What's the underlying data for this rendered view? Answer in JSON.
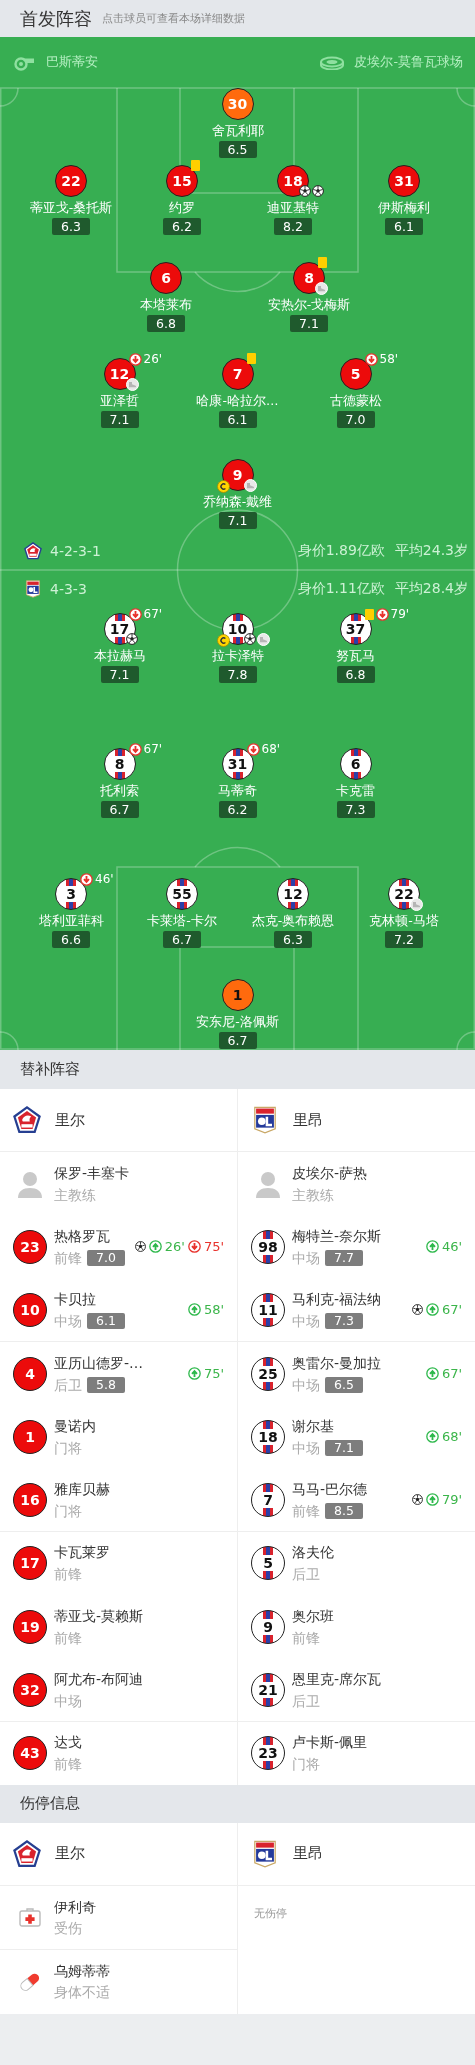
{
  "header": {
    "title": "首发阵容",
    "hint": "点击球员可查看本场详细数据"
  },
  "match_info": {
    "referee": "巴斯蒂安",
    "stadium": "皮埃尔-莫鲁瓦球场"
  },
  "home": {
    "formation": "4-2-3-1",
    "value": "身价1.89亿欧",
    "average_age": "平均24.3岁",
    "goalkeeper": {
      "number": "30",
      "name": "舍瓦利耶",
      "rating": "6.5",
      "captain": false
    },
    "lines": [
      [
        {
          "number": "22",
          "name": "蒂亚戈-桑托斯",
          "rating": "6.3",
          "captain": false
        },
        {
          "number": "15",
          "name": "约罗",
          "rating": "6.2",
          "captain": false,
          "events": [
            {
              "kind": "yellow_card"
            }
          ]
        },
        {
          "number": "18",
          "name": "迪亚基特",
          "rating": "8.2",
          "captain": false,
          "events": [
            {
              "kind": "goal"
            },
            {
              "kind": "goal"
            }
          ]
        },
        {
          "number": "31",
          "name": "伊斯梅利",
          "rating": "6.1",
          "captain": false
        }
      ],
      [
        {
          "number": "6",
          "name": "本塔莱布",
          "rating": "6.8",
          "captain": false
        },
        {
          "number": "8",
          "name": "安热尔-戈梅斯",
          "rating": "7.1",
          "captain": false,
          "events": [
            {
              "kind": "yellow_card"
            },
            {
              "kind": "assist"
            }
          ]
        }
      ],
      [
        {
          "number": "12",
          "name": "亚泽哲",
          "rating": "7.1",
          "captain": false,
          "events": [
            {
              "kind": "sub_out",
              "minute": "26'"
            },
            {
              "kind": "assist"
            }
          ]
        },
        {
          "number": "7",
          "name": "哈康-哈拉尔…",
          "rating": "6.1",
          "captain": false,
          "events": [
            {
              "kind": "yellow_card"
            }
          ]
        },
        {
          "number": "5",
          "name": "古德蒙松",
          "rating": "7.0",
          "captain": false,
          "events": [
            {
              "kind": "sub_out",
              "minute": "58'"
            }
          ]
        }
      ],
      [
        {
          "number": "9",
          "name": "乔纳森-戴维",
          "rating": "7.1",
          "captain": true,
          "events": [
            {
              "kind": "assist"
            }
          ]
        }
      ]
    ]
  },
  "away": {
    "formation": "4-3-3",
    "value": "身价1.11亿欧",
    "average_age": "平均28.4岁",
    "lines": [
      [
        {
          "number": "17",
          "name": "本拉赫马",
          "rating": "7.1",
          "captain": false,
          "events": [
            {
              "kind": "sub_out",
              "minute": "67'"
            },
            {
              "kind": "goal"
            }
          ]
        },
        {
          "number": "10",
          "name": "拉卡泽特",
          "rating": "7.8",
          "captain": true,
          "events": [
            {
              "kind": "goal"
            },
            {
              "kind": "assist"
            }
          ]
        },
        {
          "number": "37",
          "name": "努瓦马",
          "rating": "6.8",
          "captain": false,
          "events": [
            {
              "kind": "yellow_card"
            },
            {
              "kind": "sub_out",
              "minute": "79'"
            }
          ]
        }
      ],
      [
        {
          "number": "8",
          "name": "托利索",
          "rating": "6.7",
          "captain": false,
          "events": [
            {
              "kind": "sub_out",
              "minute": "67'"
            }
          ]
        },
        {
          "number": "31",
          "name": "马蒂奇",
          "rating": "6.2",
          "captain": false,
          "events": [
            {
              "kind": "sub_out",
              "minute": "68'"
            }
          ]
        },
        {
          "number": "6",
          "name": "卡克雷",
          "rating": "7.3",
          "captain": false
        }
      ],
      [
        {
          "number": "3",
          "name": "塔利亚菲科",
          "rating": "6.6",
          "captain": false,
          "events": [
            {
              "kind": "sub_out",
              "minute": "46'"
            }
          ]
        },
        {
          "number": "55",
          "name": "卡莱塔-卡尔",
          "rating": "6.7",
          "captain": false
        },
        {
          "number": "12",
          "name": "杰克-奥布赖恩",
          "rating": "6.3",
          "captain": false
        },
        {
          "number": "22",
          "name": "克林顿-马塔",
          "rating": "7.2",
          "captain": false,
          "events": [
            {
              "kind": "assist"
            }
          ]
        }
      ]
    ],
    "goalkeeper": {
      "number": "1",
      "name": "安东尼-洛佩斯",
      "rating": "6.7",
      "captain": false
    }
  },
  "substitutes": {
    "title": "替补阵容",
    "home": {
      "team": "里尔",
      "coach": {
        "name": "保罗-丰塞卡",
        "role": "主教练"
      },
      "players": [
        {
          "number": "23",
          "name": "热格罗瓦",
          "position": "前锋",
          "rating": "7.0",
          "events": [
            {
              "kind": "goal"
            },
            {
              "kind": "sub_in",
              "minute": "26'"
            },
            {
              "kind": "sub_out",
              "minute": "75'"
            }
          ]
        },
        {
          "number": "10",
          "name": "卡贝拉",
          "position": "中场",
          "rating": "6.1",
          "events": [
            {
              "kind": "sub_in",
              "minute": "58'"
            }
          ]
        },
        {
          "number": "4",
          "name": "亚历山德罗-…",
          "position": "后卫",
          "rating": "5.8",
          "events": [
            {
              "kind": "sub_in",
              "minute": "75'"
            }
          ]
        },
        {
          "number": "1",
          "name": "曼诺内",
          "position": "门将"
        },
        {
          "number": "16",
          "name": "雅库贝赫",
          "position": "门将"
        },
        {
          "number": "17",
          "name": "卡瓦莱罗",
          "position": "前锋"
        },
        {
          "number": "19",
          "name": "蒂亚戈-莫赖斯",
          "position": "前锋"
        },
        {
          "number": "32",
          "name": "阿尤布-布阿迪",
          "position": "中场"
        },
        {
          "number": "43",
          "name": "达戈",
          "position": "前锋"
        }
      ]
    },
    "away": {
      "team": "里昂",
      "coach": {
        "name": "皮埃尔-萨热",
        "role": "主教练"
      },
      "players": [
        {
          "number": "98",
          "name": "梅特兰-奈尔斯",
          "position": "中场",
          "rating": "7.7",
          "events": [
            {
              "kind": "sub_in",
              "minute": "46'"
            }
          ]
        },
        {
          "number": "11",
          "name": "马利克-福法纳",
          "position": "中场",
          "rating": "7.3",
          "events": [
            {
              "kind": "goal"
            },
            {
              "kind": "sub_in",
              "minute": "67'"
            }
          ]
        },
        {
          "number": "25",
          "name": "奥雷尔-曼加拉",
          "position": "中场",
          "rating": "6.5",
          "events": [
            {
              "kind": "sub_in",
              "minute": "67'"
            }
          ]
        },
        {
          "number": "18",
          "name": "谢尔基",
          "position": "中场",
          "rating": "7.1",
          "events": [
            {
              "kind": "sub_in",
              "minute": "68'"
            }
          ]
        },
        {
          "number": "7",
          "name": "马马-巴尔德",
          "position": "前锋",
          "rating": "8.5",
          "events": [
            {
              "kind": "goal"
            },
            {
              "kind": "sub_in",
              "minute": "79'"
            }
          ]
        },
        {
          "number": "5",
          "name": "洛夫伦",
          "position": "后卫"
        },
        {
          "number": "9",
          "name": "奥尔班",
          "position": "前锋"
        },
        {
          "number": "21",
          "name": "恩里克-席尔瓦",
          "position": "后卫"
        },
        {
          "number": "23",
          "name": "卢卡斯-佩里",
          "position": "门将"
        }
      ]
    }
  },
  "injuries": {
    "title": "伤停信息",
    "home": {
      "team": "里尔",
      "players": [
        {
          "name": "伊利奇",
          "reason": "受伤",
          "kind": "injury"
        },
        {
          "name": "乌姆蒂蒂",
          "reason": "身体不适",
          "kind": "illness"
        }
      ]
    },
    "away": {
      "team": "里昂",
      "empty_text": "无伤停"
    }
  }
}
